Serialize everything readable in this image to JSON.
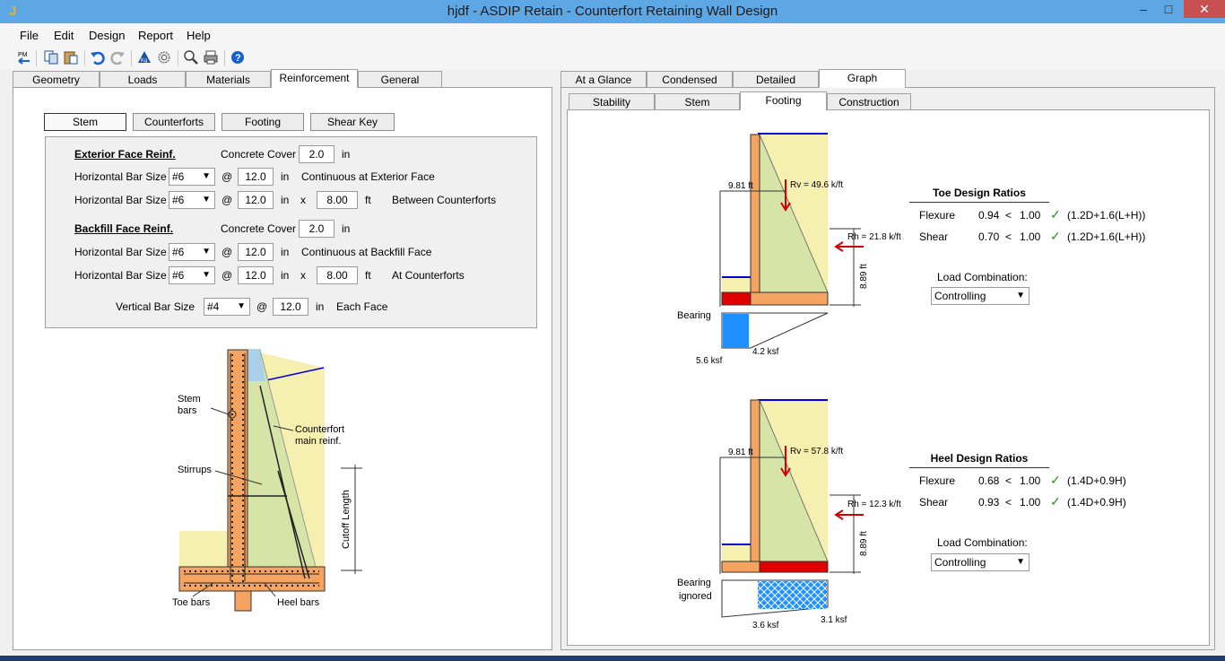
{
  "window": {
    "title": "hjdf - ASDIP Retain - Counterfort Retaining Wall Design"
  },
  "menu": [
    "File",
    "Edit",
    "Design",
    "Report",
    "Help"
  ],
  "left_tabs": [
    "Geometry",
    "Loads",
    "Materials",
    "Reinforcement",
    "General"
  ],
  "sub_buttons": [
    "Stem",
    "Counterforts",
    "Footing",
    "Shear Key"
  ],
  "reinf": {
    "ext_header": "Exterior Face Reinf.",
    "concrete_cover_label": "Concrete Cover",
    "ext_cover": "2.0",
    "in": "in",
    "ft": "ft",
    "at": "@",
    "x": "x",
    "hbar_label": "Horizontal Bar Size",
    "ext_bar1": "#6",
    "ext_sp1": "12.0",
    "ext_desc1": "Continuous at Exterior Face",
    "ext_bar2": "#6",
    "ext_sp2": "12.0",
    "ext_len2": "8.00",
    "ext_desc2": "Between Counterforts",
    "back_header": "Backfill Face Reinf.",
    "back_cover": "2.0",
    "back_bar1": "#6",
    "back_sp1": "12.0",
    "back_desc1": "Continuous at Backfill Face",
    "back_bar2": "#6",
    "back_sp2": "12.0",
    "back_len2": "8.00",
    "back_desc2": "At Counterforts",
    "vbar_label": "Vertical Bar Size",
    "vbar": "#4",
    "vbar_sp": "12.0",
    "vbar_desc": "Each Face"
  },
  "wall_diagram": {
    "stem_bars": "Stem\nbars",
    "stem_bars_1": "Stem",
    "stem_bars_2": "bars",
    "counterfort_1": "Counterfort",
    "counterfort_2": "main reinf.",
    "stirrups": "Stirrups",
    "cutoff": "Cutoff Length",
    "toe_bars": "Toe bars",
    "heel_bars": "Heel bars"
  },
  "right_tabs": [
    "At a Glance",
    "Condensed",
    "Detailed",
    "Graph"
  ],
  "right_subtabs": [
    "Stability",
    "Stem",
    "Footing",
    "Construction"
  ],
  "toe": {
    "title": "Toe Design Ratios",
    "rows": [
      {
        "name": "Flexure",
        "val": "0.94",
        "op": "<",
        "lim": "1.00",
        "combo": "(1.2D+1.6(L+H))"
      },
      {
        "name": "Shear",
        "val": "0.70",
        "op": "<",
        "lim": "1.00",
        "combo": "(1.2D+1.6(L+H))"
      }
    ],
    "load_label": "Load Combination:",
    "load_value": "Controlling",
    "dim_top": "9.81 ft",
    "rv": "Rv = 49.6 k/ft",
    "rh": "Rh = 21.8 k/ft",
    "dim_side": "8.89 ft",
    "bearing": "Bearing",
    "p1": "5.6 ksf",
    "p2": "4.2 ksf"
  },
  "heel": {
    "title": "Heel Design Ratios",
    "rows": [
      {
        "name": "Flexure",
        "val": "0.68",
        "op": "<",
        "lim": "1.00",
        "combo": "(1.4D+0.9H)"
      },
      {
        "name": "Shear",
        "val": "0.93",
        "op": "<",
        "lim": "1.00",
        "combo": "(1.4D+0.9H)"
      }
    ],
    "load_label": "Load Combination:",
    "load_value": "Controlling",
    "dim_top": "9.81 ft",
    "rv": "Rv = 57.8 k/ft",
    "rh": "Rh = 12.3 k/ft",
    "dim_side": "8.89 ft",
    "bearing1": "Bearing",
    "bearing2": "ignored",
    "p1": "3.6 ksf",
    "p2": "3.1 ksf"
  },
  "colors": {
    "titlebar": "#5ea7e5",
    "concrete": "#f4a460",
    "soil": "#f5efb0",
    "wedge": "#d6e4a8",
    "water": "#1e90ff",
    "red": "#e00000"
  }
}
